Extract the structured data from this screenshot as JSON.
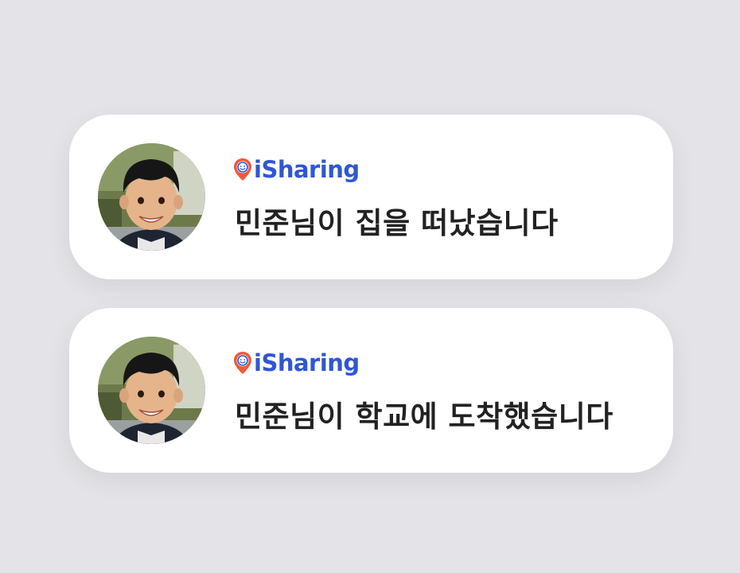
{
  "notifications": [
    {
      "app_name": "iSharing",
      "app_icon": "location-pin-smiley-icon",
      "avatar": "child-avatar-photo",
      "message": "민준님이 집을 떠났습니다"
    },
    {
      "app_name": "iSharing",
      "app_icon": "location-pin-smiley-icon",
      "avatar": "child-avatar-photo",
      "message": "민준님이 학교에 도착했습니다"
    }
  ],
  "colors": {
    "background": "#e3e3e8",
    "card": "#ffffff",
    "brand_blue": "#2f56d6",
    "pin_orange": "#ee5a3c",
    "message_text": "#222222"
  }
}
